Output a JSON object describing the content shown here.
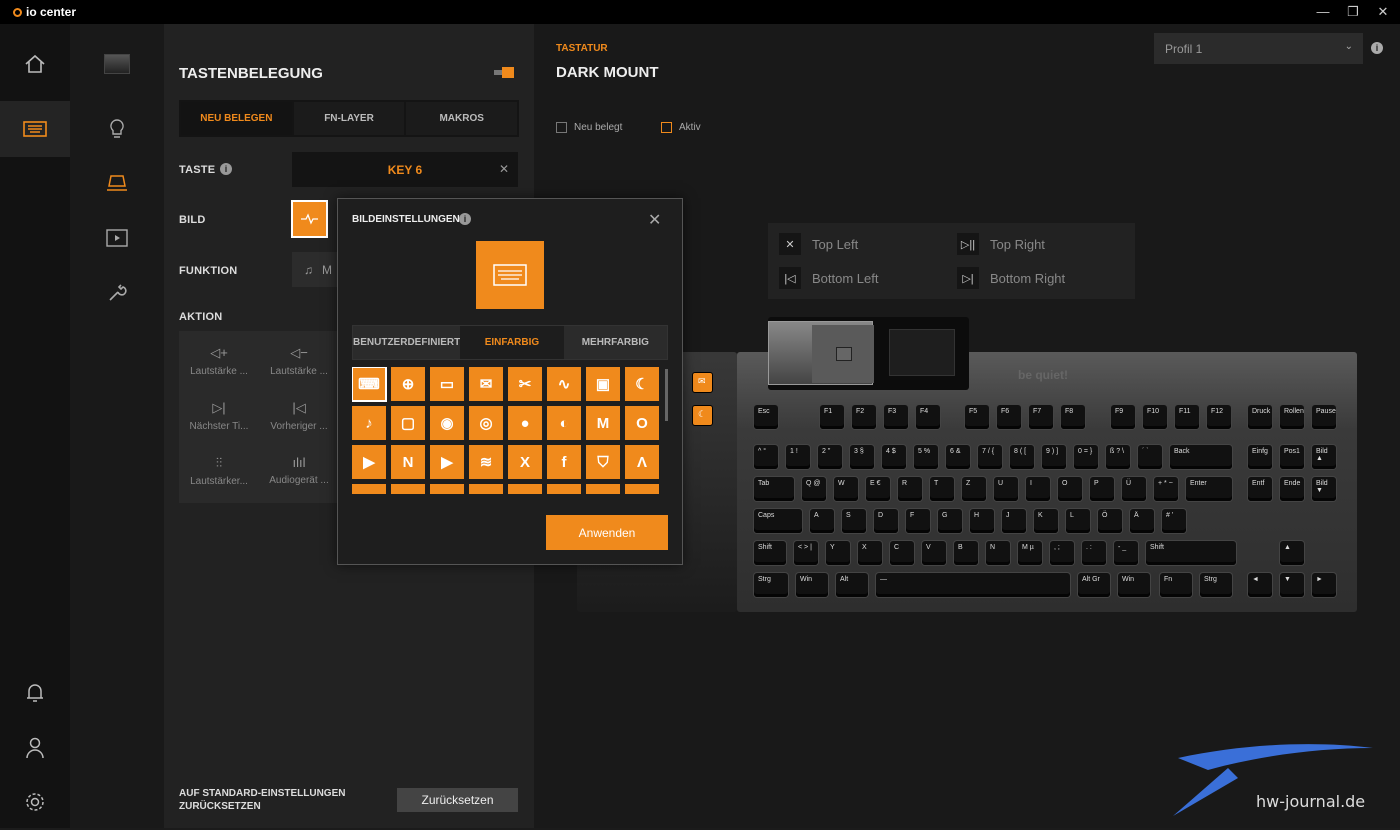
{
  "app": {
    "title": "io center"
  },
  "header": {
    "section": "TASTATUR",
    "title": "DARK MOUNT",
    "profile": "Profil 1"
  },
  "filters": {
    "reassigned": "Neu belegt",
    "active": "Aktiv"
  },
  "panel": {
    "title": "TASTENBELEGUNG",
    "tabs": [
      "NEU BELEGEN",
      "FN-LAYER",
      "MAKROS"
    ],
    "taste_label": "TASTE",
    "key_value": "KEY 6",
    "bild_label": "BILD",
    "funktion_label": "FUNKTION",
    "funktion_value": "M",
    "aktion_label": "AKTION",
    "actions": [
      "Lautstärke ...",
      "Lautstärke ...",
      "Nächster Ti...",
      "Vorheriger ...",
      "Lautstärker...",
      "Audiogerät ..."
    ],
    "reset_label": "AUF STANDARD-EINSTELLUNGEN ZURÜCKSETZEN",
    "reset_button": "Zurücksetzen"
  },
  "dialog": {
    "title": "BILDEINSTELLUNGEN",
    "tabs": [
      "BENUTZERDEFINIERT",
      "EINFARBIG",
      "MEHRFARBIG"
    ],
    "apply": "Anwenden",
    "icons": [
      "keyboard-icon",
      "globe-icon",
      "folder-icon",
      "mail-icon",
      "scissors-icon",
      "pulse-icon",
      "lock-icon",
      "moon-icon",
      "tiktok-icon",
      "twitch-icon",
      "reddit-icon",
      "chrome-icon",
      "firefox-icon",
      "edge-icon",
      "gmail-icon",
      "outlook-icon",
      "prime-video-icon",
      "netflix-icon",
      "youtube-icon",
      "spotify-icon",
      "x-icon",
      "facebook-icon",
      "shield-icon",
      "arrow-icon"
    ]
  },
  "corners": {
    "top_left": "Top Left",
    "top_right": "Top Right",
    "bottom_left": "Bottom Left",
    "bottom_right": "Bottom Right"
  },
  "keyboard": {
    "brand": "be quiet!",
    "row1": [
      "Esc",
      "F1",
      "F2",
      "F3",
      "F4",
      "F5",
      "F6",
      "F7",
      "F8",
      "F9",
      "F10",
      "F11",
      "F12",
      "Druck",
      "Rollen",
      "Pause"
    ],
    "row2": [
      "^ °",
      "1 !",
      "2 \"",
      "3 §",
      "4 $",
      "5 %",
      "6 &",
      "7 / {",
      "8 ( [",
      "9 ) ]",
      "0 = }",
      "ß ? \\",
      "´ `",
      "Back",
      "Einfg",
      "Pos1",
      "Bild ▲"
    ],
    "row3": [
      "Tab",
      "Q @",
      "W",
      "E €",
      "R",
      "T",
      "Z",
      "U",
      "I",
      "O",
      "P",
      "Ü",
      "+ * ~",
      "Enter",
      "Entf",
      "Ende",
      "Bild ▼"
    ],
    "row4": [
      "Caps",
      "A",
      "S",
      "D",
      "F",
      "G",
      "H",
      "J",
      "K",
      "L",
      "Ö",
      "Ä",
      "# '"
    ],
    "row5": [
      "Shift",
      "< > |",
      "Y",
      "X",
      "C",
      "V",
      "B",
      "N",
      "M µ",
      ", ;",
      ". :",
      "- _",
      "Shift",
      "▲"
    ],
    "row6": [
      "Strg",
      "Win",
      "Alt",
      "—",
      "Alt Gr",
      "Win",
      "Fn",
      "Strg",
      "◄",
      "▼",
      "►"
    ]
  },
  "watermark": "hw-journal.de"
}
